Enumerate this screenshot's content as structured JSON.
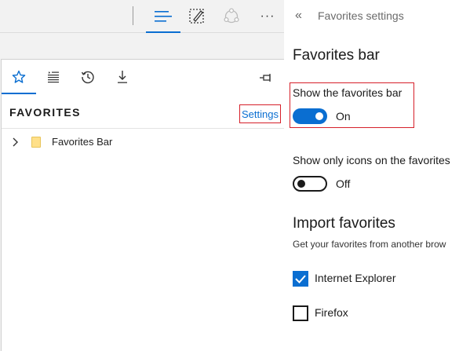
{
  "toolbar": {
    "icons": [
      "hub-icon",
      "web-note-icon",
      "share-icon",
      "more-icon"
    ],
    "more_label": "···"
  },
  "hub": {
    "tabs": [
      "favorites-star-icon",
      "reading-list-icon",
      "history-icon",
      "downloads-icon"
    ],
    "active_tab": "favorites",
    "header": "FAVORITES",
    "settings_link": "Settings",
    "items": [
      {
        "label": "Favorites Bar",
        "icon": "folder-icon"
      }
    ]
  },
  "settings_panel": {
    "back_glyph": "«",
    "title": "Favorites settings",
    "favorites_bar": {
      "heading": "Favorites bar",
      "show_bar": {
        "label": "Show the favorites bar",
        "state": "On",
        "enabled": true
      },
      "icons_only": {
        "label": "Show only icons on the favorites",
        "state": "Off",
        "enabled": false
      }
    },
    "import": {
      "heading": "Import favorites",
      "description": "Get your favorites from another brow",
      "options": [
        {
          "label": "Internet Explorer",
          "checked": true
        },
        {
          "label": "Firefox",
          "checked": false
        }
      ]
    }
  },
  "colors": {
    "accent": "#0a6ed1",
    "highlight_box": "#d6202a",
    "folder": "#ffe08a"
  }
}
